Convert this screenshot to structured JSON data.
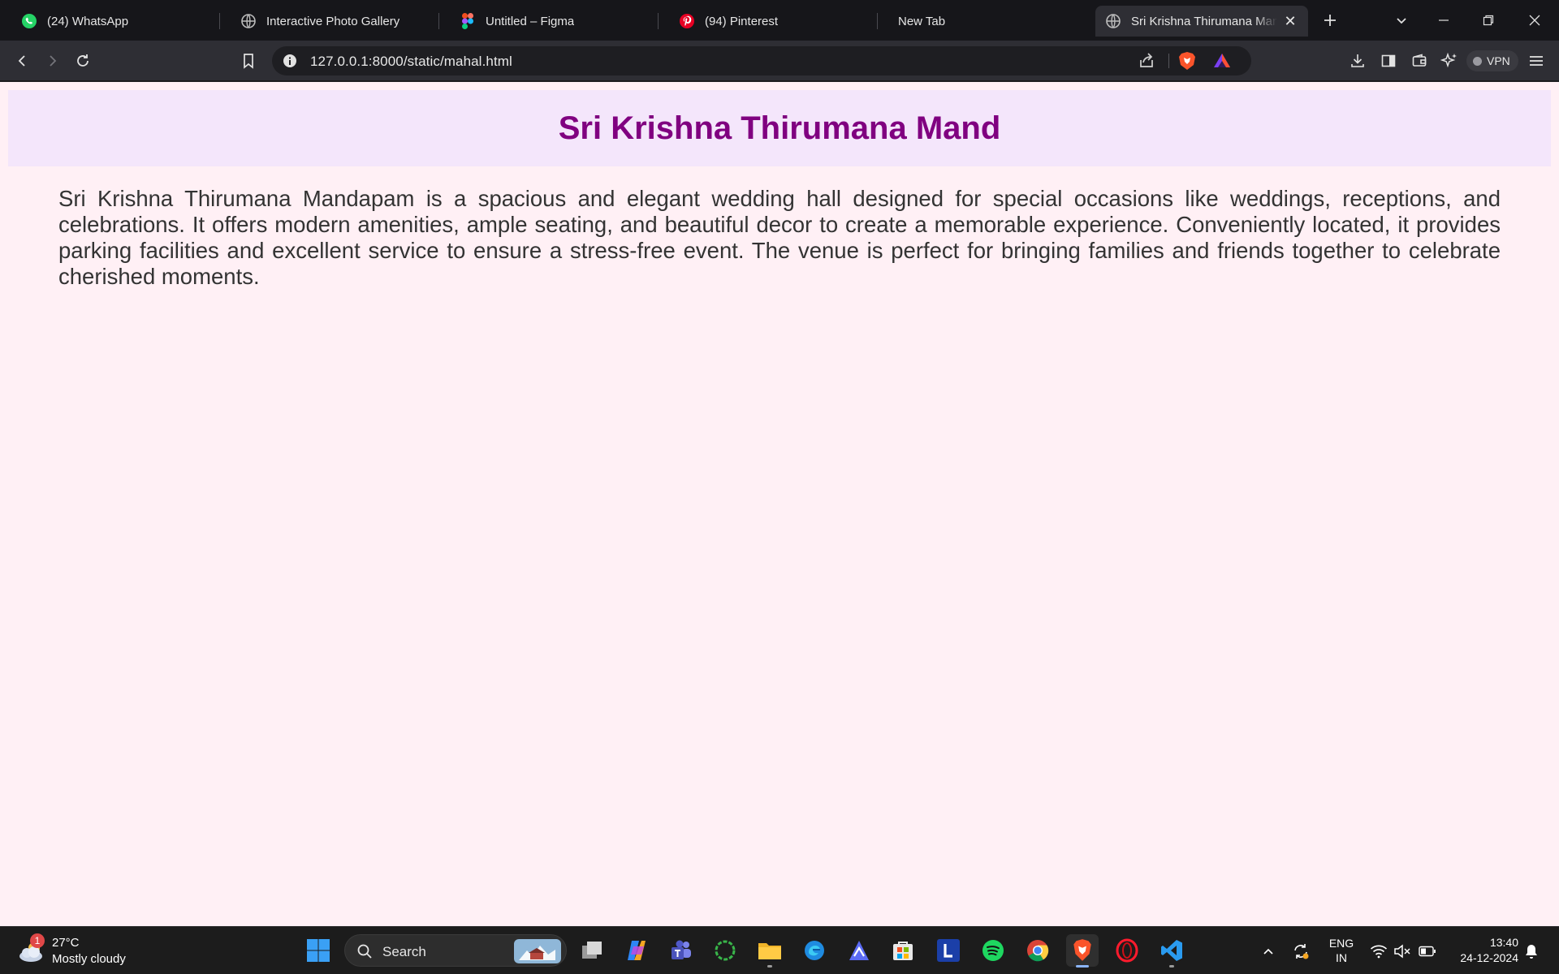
{
  "browser": {
    "tabs": [
      {
        "title": "(24) WhatsApp",
        "icon": "whatsapp-icon"
      },
      {
        "title": "Interactive Photo Gallery",
        "icon": "globe-icon"
      },
      {
        "title": "Untitled – Figma",
        "icon": "figma-icon"
      },
      {
        "title": "(94) Pinterest",
        "icon": "pinterest-icon"
      },
      {
        "title": "New Tab",
        "icon": ""
      },
      {
        "title": "Sri Krishna Thirumana Mandapam",
        "icon": "globe-icon",
        "active": true
      }
    ],
    "url": "127.0.0.1:8000/static/mahal.html",
    "vpn_label": "VPN"
  },
  "page": {
    "title": "Sri Krishna Thirumana Mand",
    "description": "Sri Krishna Thirumana Mandapam is a spacious and elegant wedding hall designed for special occasions like weddings, receptions, and celebrations. It offers modern amenities, ample seating, and beautiful decor to create a memorable experience. Conveniently located, it provides parking facilities and excellent service to ensure a stress-free event. The venue is perfect for bringing families and friends together to celebrate cherished moments.",
    "colors": {
      "background": "#fff0f5",
      "header_bg": "#f4e6fb",
      "title": "#800080",
      "text": "#333333"
    }
  },
  "taskbar": {
    "weather": {
      "badge": "1",
      "temp": "27°C",
      "condition": "Mostly cloudy"
    },
    "search_placeholder": "Search",
    "lang_primary": "ENG",
    "lang_secondary": "IN",
    "time": "13:40",
    "date": "24-12-2024"
  }
}
